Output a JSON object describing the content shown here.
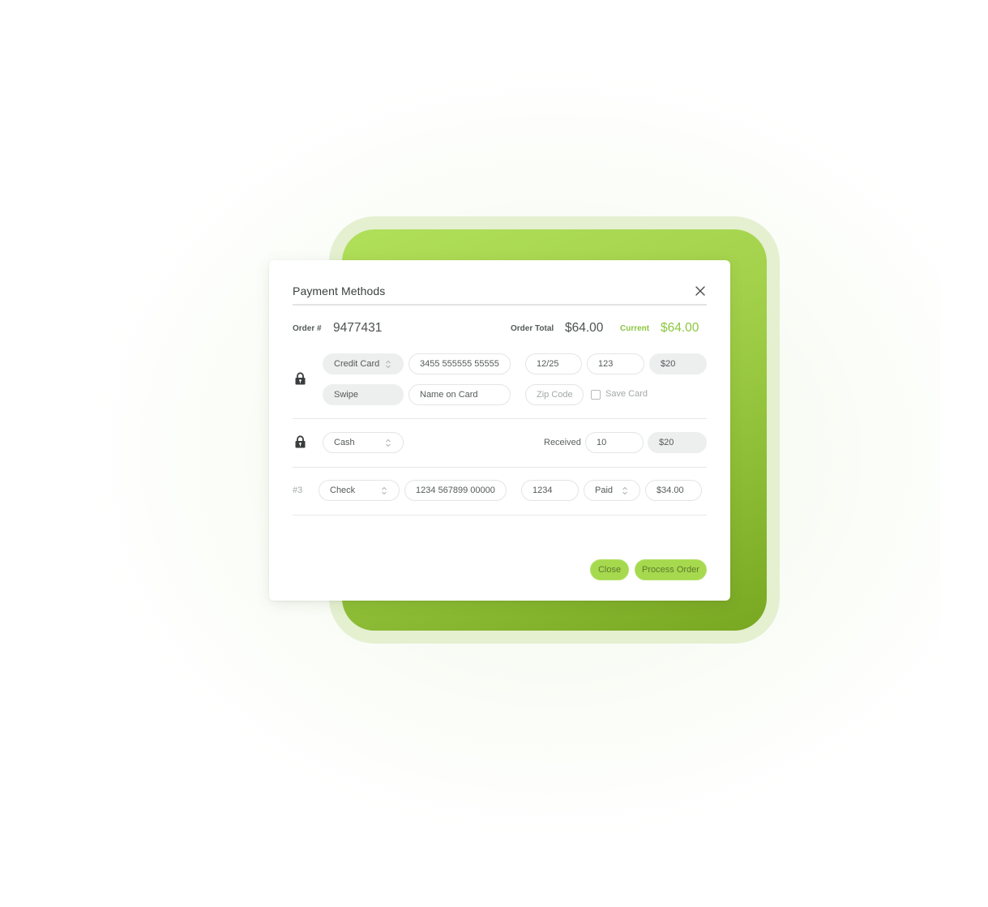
{
  "modal": {
    "title": "Payment Methods",
    "close_icon": "close-icon"
  },
  "order": {
    "order_label": "Order #",
    "order_number": "9477431",
    "total_label": "Order Total",
    "total_value": "$64.00",
    "current_label": "Current",
    "current_value": "$64.00"
  },
  "payments": {
    "credit_card": {
      "lock_icon": "lock-icon",
      "type_select": "Credit Card",
      "card_number": "3455 555555 55555",
      "expiry": "12/25",
      "cvv": "123",
      "amount": "$20",
      "entry_mode": "Swipe",
      "name_placeholder": "Name on Card",
      "zip_placeholder": "Zip Code",
      "save_card_label": "Save Card",
      "save_card_checked": false
    },
    "cash": {
      "lock_icon": "lock-icon",
      "type_select": "Cash",
      "received_label": "Received",
      "received_value": "10",
      "amount": "$20"
    },
    "check": {
      "index_label": "#3",
      "type_select": "Check",
      "account_number": "1234 567899 00000",
      "check_number": "1234",
      "status_select": "Paid",
      "amount": "$34.00"
    }
  },
  "footer": {
    "close_label": "Close",
    "process_label": "Process Order"
  },
  "colors": {
    "accent": "#a6d94e",
    "accent_text": "#8cc63f",
    "deco_frame": "#e4f0d0"
  }
}
